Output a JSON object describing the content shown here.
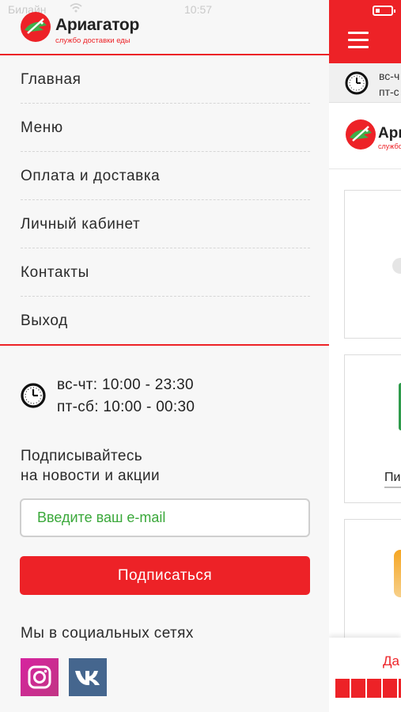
{
  "status_bar": {
    "carrier": "Билайн",
    "time": "10:57"
  },
  "brand": {
    "name": "Ариагатор",
    "tagline": "службо доставки еды"
  },
  "menu": {
    "items": [
      {
        "label": "Главная"
      },
      {
        "label": "Меню"
      },
      {
        "label": "Оплата и доставка"
      },
      {
        "label": "Личный кабинет"
      },
      {
        "label": "Контакты"
      },
      {
        "label": "Выход"
      }
    ]
  },
  "hours": {
    "line1": "вс-чт: 10:00 - 23:30",
    "line2": "пт-сб: 10:00 - 00:30"
  },
  "subscribe": {
    "title_line1": "Подписывайтесь",
    "title_line2": "на новости и акции",
    "email_placeholder": "Введите ваш e-mail",
    "button_label": "Подписаться"
  },
  "social": {
    "title": "Мы в социальных сетях",
    "networks": [
      "instagram-icon",
      "vk-icon"
    ]
  },
  "app_behind": {
    "hours_line1": "вс-ч",
    "hours_line2": "пт-с",
    "brand_partial": "Ари",
    "tagline_partial": "службо",
    "card_label_partial": "Пи",
    "bottom_label_partial": "Да"
  },
  "colors": {
    "accent": "#ed2227",
    "placeholder": "#3aa83a",
    "drawer_bg": "#f7f7f7",
    "vk": "#45668e",
    "instagram": "#c13584"
  }
}
